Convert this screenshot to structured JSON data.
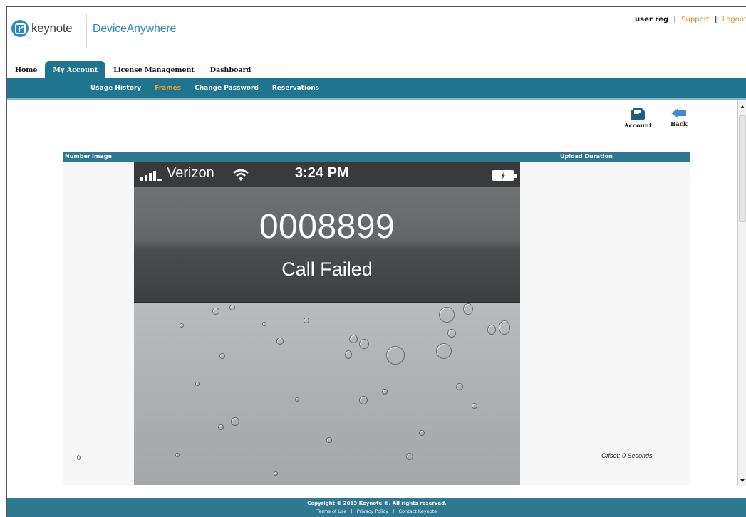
{
  "header": {
    "brand": "keynote",
    "product": "DeviceAnywhere",
    "user": "user reg",
    "links": [
      "Support",
      "Logout"
    ],
    "separator": "|"
  },
  "main_tabs": [
    "Home",
    "My Account",
    "License Management",
    "Dashboard"
  ],
  "active_main_tab": "My Account",
  "subnav": [
    "Usage History",
    "Frames",
    "Change Password",
    "Reservations"
  ],
  "active_subnav": "Frames",
  "actions": {
    "account_label": "Account",
    "back_label": "Back"
  },
  "table": {
    "columns": [
      "Number",
      "Image",
      "Upload Duration"
    ],
    "rows": [
      {
        "number": "0",
        "offset": "Offset: 0 Seconds"
      }
    ]
  },
  "phone": {
    "carrier": "Verizon",
    "time": "3:24 PM",
    "number": "0008899",
    "status": "Call Failed"
  },
  "footer": {
    "copyright": "Copyright © 2013 Keynote ®. All rights reserved.",
    "links": [
      "Terms of Use",
      "Privacy Policy",
      "Contact Keynote"
    ],
    "separator": "|"
  },
  "colors": {
    "nav": "#1f7590",
    "accent": "#f3a11c",
    "link": "#e38a1c",
    "brand": "#2a8ac0"
  }
}
